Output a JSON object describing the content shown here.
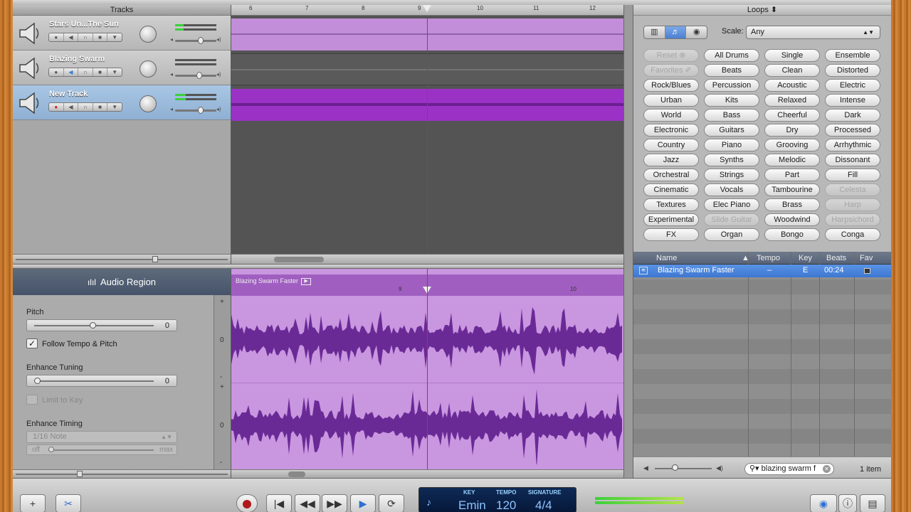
{
  "tracks_header": "Tracks",
  "ruler": {
    "ticks": [
      "6",
      "7",
      "8",
      "9",
      "10",
      "11",
      "12"
    ]
  },
  "tracks": [
    {
      "name": "Stars Un...The Sun",
      "selected": false
    },
    {
      "name": "Blazing Swarm",
      "selected": false
    },
    {
      "name": "New Track",
      "selected": true
    }
  ],
  "editor": {
    "title": "Audio Region",
    "pitch_label": "Pitch",
    "pitch_value": "0",
    "follow_label": "Follow Tempo & Pitch",
    "follow_checked": "✓",
    "tuning_label": "Enhance Tuning",
    "tuning_value": "0",
    "limit_label": "Limit to Key",
    "timing_label": "Enhance Timing",
    "timing_note": "1/16 Note",
    "timing_min": "off",
    "timing_max": "max",
    "scale_plus_1": "+",
    "scale_zero_1": "0",
    "scale_minus_1": "-",
    "scale_plus_2": "+",
    "scale_zero_2": "0",
    "scale_minus_2": "-",
    "region_name": "Blazing Swarm Faster",
    "region_ticks": [
      "9",
      "10"
    ]
  },
  "loops": {
    "header": "Loops",
    "scale_label": "Scale:",
    "scale_value": "Any",
    "view_buttons": [
      "▥",
      "♬",
      "◉"
    ],
    "keywords": [
      [
        "Reset ⊗",
        "All Drums",
        "Single",
        "Ensemble"
      ],
      [
        "Favorites ✐",
        "Beats",
        "Clean",
        "Distorted"
      ],
      [
        "Rock/Blues",
        "Percussion",
        "Acoustic",
        "Electric"
      ],
      [
        "Urban",
        "Kits",
        "Relaxed",
        "Intense"
      ],
      [
        "World",
        "Bass",
        "Cheerful",
        "Dark"
      ],
      [
        "Electronic",
        "Guitars",
        "Dry",
        "Processed"
      ],
      [
        "Country",
        "Piano",
        "Grooving",
        "Arrhythmic"
      ],
      [
        "Jazz",
        "Synths",
        "Melodic",
        "Dissonant"
      ],
      [
        "Orchestral",
        "Strings",
        "Part",
        "Fill"
      ],
      [
        "Cinematic",
        "Vocals",
        "Tambourine",
        "Celesta"
      ],
      [
        "Textures",
        "Elec Piano",
        "Brass",
        "Harp"
      ],
      [
        "Experimental",
        "Slide Guitar",
        "Woodwind",
        "Harpsichord"
      ],
      [
        "FX",
        "Organ",
        "Bongo",
        "Conga"
      ]
    ],
    "disabled_keywords": [
      "Reset ⊗",
      "Favorites ✐",
      "Celesta",
      "Harp",
      "Slide Guitar",
      "Harpsichord"
    ],
    "columns": {
      "name": "Name",
      "tempo": "Tempo",
      "key": "Key",
      "beats": "Beats",
      "fav": "Fav"
    },
    "result": {
      "name": "Blazing Swarm Faster",
      "tempo": "–",
      "key": "E",
      "beats": "00:24"
    },
    "search_value": "blazing swarm f",
    "count": "1 item"
  },
  "transport": {
    "add_label": "+",
    "lcd": {
      "key_label": "KEY",
      "key_value": "Emin",
      "tempo_label": "TEMPO",
      "tempo_value": "120",
      "sig_label": "SIGNATURE",
      "sig_value": "4/4"
    }
  }
}
